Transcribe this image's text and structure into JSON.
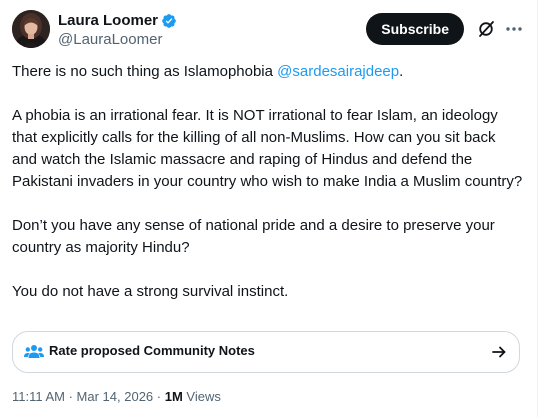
{
  "author": {
    "display_name": "Laura Loomer",
    "handle": "@LauraLoomer",
    "verified": true,
    "avatar_icon": "profile-avatar"
  },
  "header": {
    "subscribe_label": "Subscribe",
    "grok_icon": "grok-icon",
    "more_icon": "more-dots-icon"
  },
  "tweet": {
    "line1_text": "There is no such thing as Islamophobia ",
    "line1_mention": "@sardesairajdeep",
    "line1_end": ".",
    "para2": "A phobia is an irrational fear. It is NOT irrational to fear Islam, an ideology that explicitly calls for the killing of all non-Muslims. How can you sit back and watch the Islamic massacre and raping of Hindus and defend the Pakistani invaders in your country who wish to make India a Muslim country?",
    "para3": "Don’t you have any sense of national pride and a desire to preserve your country as majority Hindu?",
    "para4": "You do not have a strong survival instinct."
  },
  "community_notes": {
    "label": "Rate proposed Community Notes",
    "icon": "people-icon",
    "arrow_icon": "arrow-right-icon"
  },
  "meta": {
    "timestamp": "11:11 AM · Mar 14, 2026",
    "separator": " · ",
    "views_count": "1M",
    "views_label": " Views"
  },
  "colors": {
    "accent": "#1d9bf0",
    "text_primary": "#0f1419",
    "text_secondary": "#536471",
    "border": "#cfd9de"
  }
}
